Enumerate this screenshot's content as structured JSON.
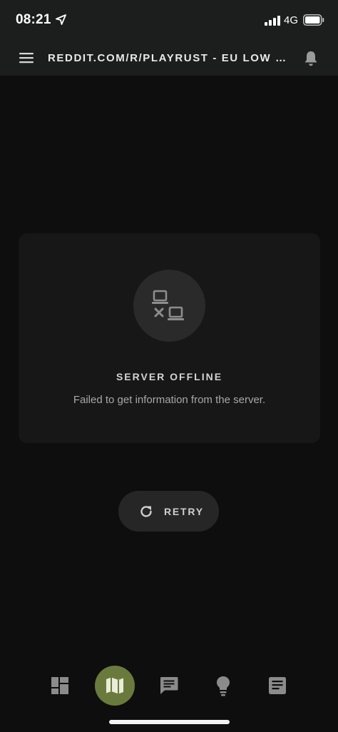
{
  "status_bar": {
    "time": "08:21",
    "network": "4G"
  },
  "app_bar": {
    "title": "REDDIT.COM/R/PLAYRUST - EU LOW POP"
  },
  "offline_card": {
    "icon": "network-offline-icon",
    "title": "SERVER OFFLINE",
    "message": "Failed to get information from the server."
  },
  "retry_button": {
    "label": "RETRY",
    "icon": "refresh-icon"
  },
  "bottom_nav": {
    "items": [
      {
        "icon": "dashboard-icon",
        "active": false
      },
      {
        "icon": "map-icon",
        "active": true
      },
      {
        "icon": "chat-icon",
        "active": false
      },
      {
        "icon": "lightbulb-icon",
        "active": false
      },
      {
        "icon": "article-icon",
        "active": false
      }
    ]
  },
  "colors": {
    "background": "#0e0e0e",
    "bar": "#1c1d1d",
    "card": "#171717",
    "accent": "#6a7a3c",
    "icon": "#8b8b8b"
  }
}
